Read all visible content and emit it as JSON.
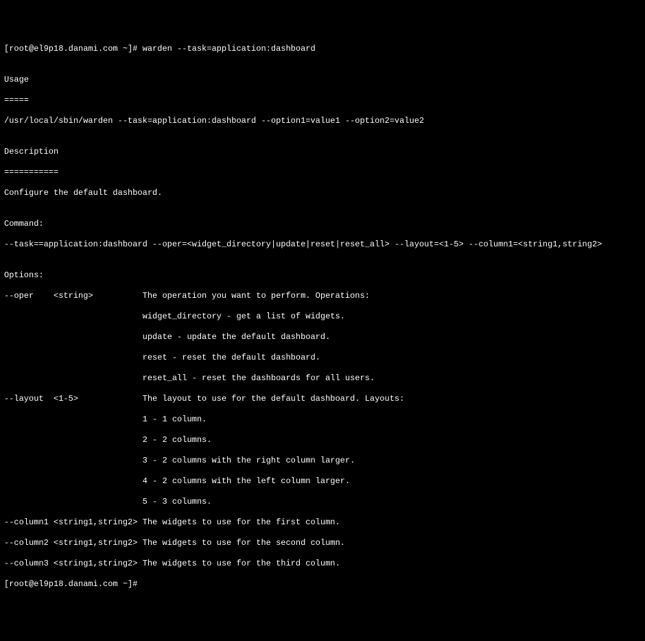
{
  "prompt1": {
    "full": "[root@el9p18.danami.com ~]# warden --task=application:dashboard"
  },
  "blank": "",
  "usage_header": "Usage",
  "usage_underline": "=====",
  "usage_line": "/usr/local/sbin/warden --task=application:dashboard --option1=value1 --option2=value2",
  "description_header": "Description",
  "description_underline": "===========",
  "description_line": "Configure the default dashboard.",
  "command_header": "Command:",
  "command_line": "--task==application:dashboard --oper=<widget_directory|update|reset|reset_all> --layout=<1-5> --column1=<string1,string2>",
  "options_header": "Options:",
  "oper_line1": "--oper    <string>          The operation you want to perform. Operations:",
  "oper_line2": "                            widget_directory - get a list of widgets.",
  "oper_line3": "                            update - update the default dashboard.",
  "oper_line4": "                            reset - reset the default dashboard.",
  "oper_line5": "                            reset_all - reset the dashboards for all users.",
  "layout_line1": "--layout  <1-5>             The layout to use for the default dashboard. Layouts:",
  "layout_line2": "                            1 - 1 column.",
  "layout_line3": "                            2 - 2 columns.",
  "layout_line4": "                            3 - 2 columns with the right column larger.",
  "layout_line5": "                            4 - 2 columns with the left column larger.",
  "layout_line6": "                            5 - 3 columns.",
  "column1_line": "--column1 <string1,string2> The widgets to use for the first column.",
  "column2_line": "--column2 <string1,string2> The widgets to use for the second column.",
  "column3_line": "--column3 <string1,string2> The widgets to use for the third column.",
  "prompt2": "[root@el9p18.danami.com ~]# "
}
